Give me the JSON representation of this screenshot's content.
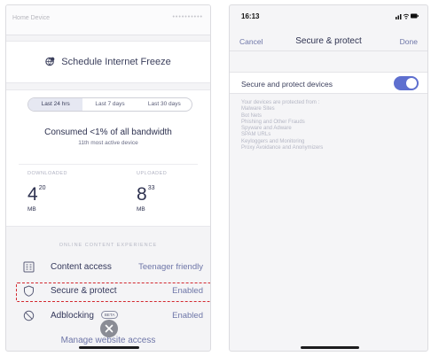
{
  "left": {
    "header_label": "Home Device",
    "header_dots": "••••••••••",
    "schedule_label": "Schedule Internet Freeze",
    "ranges": [
      "Last 24 hrs",
      "Last 7 days",
      "Last 30 days"
    ],
    "consumed": "Consumed <1% of all bandwidth",
    "subtext": "11th most active device",
    "downloaded": {
      "caption": "DOWNLOADED",
      "major": "4",
      "minor": "20",
      "unit": "MB"
    },
    "uploaded": {
      "caption": "UPLOADED",
      "major": "8",
      "minor": "33",
      "unit": "MB"
    },
    "section_header": "ONLINE CONTENT EXPERIENCE",
    "rows": [
      {
        "name": "Content access",
        "value": "Teenager friendly"
      },
      {
        "name": "Secure & protect",
        "value": "Enabled"
      },
      {
        "name": "Adblocking",
        "badge": "BETA",
        "value": "Enabled"
      }
    ],
    "manage_link": "Manage website access"
  },
  "right": {
    "time": "16:13",
    "cancel": "Cancel",
    "title": "Secure & protect",
    "done": "Done",
    "toggle_label": "Secure and protect devices",
    "toggle_on": true,
    "accent_color": "#5e6fcf",
    "protected_intro": "Your devices are protected from :",
    "protected_items": [
      "Malware Sites",
      "Bot Nets",
      "Phishing and Other Frauds",
      "Spyware and Adware",
      "SPAM URLs",
      "Keyloggers and Monitoring",
      "Proxy Avoidance and Anonymizers"
    ]
  },
  "highlight_color": "#d3282f"
}
